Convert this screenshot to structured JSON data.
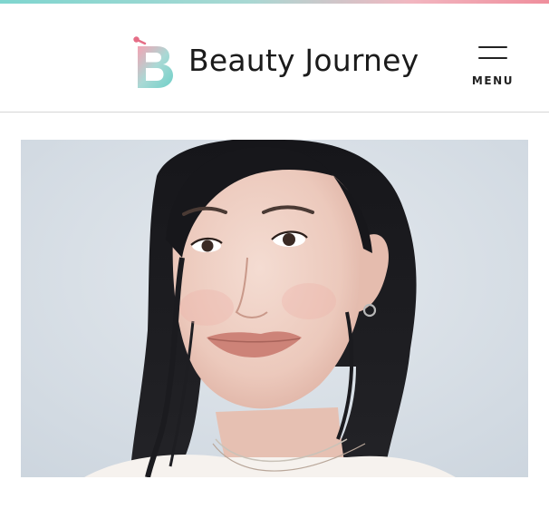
{
  "header": {
    "brand": "Beauty Journey",
    "menu_label": "MENU",
    "logo_icon": "beauty-journey-b-logo",
    "menu_icon": "hamburger-icon"
  },
  "hero": {
    "image": "portrait-photo",
    "alt": "Portrait of a smiling woman with dark hair against a light background"
  },
  "colors": {
    "gradient_start": "#7fd6cf",
    "gradient_end": "#ef8e9c",
    "text": "#1b1b1b"
  }
}
